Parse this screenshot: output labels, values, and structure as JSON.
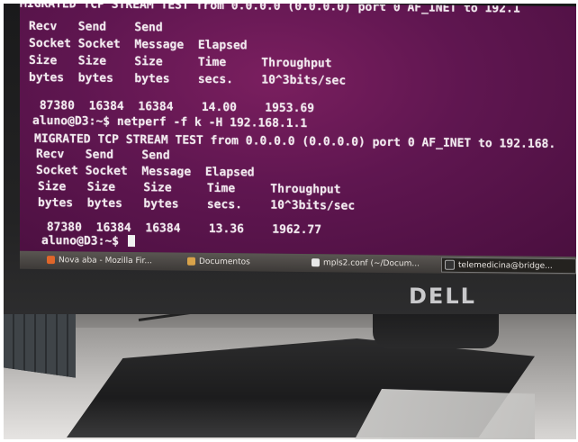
{
  "terminal": {
    "lines": [
      "MIGRATED TCP STREAM TEST from 0.0.0.0 (0.0.0.0) port 0 AF_INET to 192.1",
      "Recv   Send    Send",
      "Socket Socket  Message  Elapsed",
      "Size   Size    Size     Time     Throughput",
      "bytes  bytes   bytes    secs.    10^3bits/sec",
      "",
      " 87380  16384  16384    14.00    1953.69",
      "aluno@D3:~$ netperf -f k -H 192.168.1.1",
      "MIGRATED TCP STREAM TEST from 0.0.0.0 (0.0.0.0) port 0 AF_INET to 192.168.",
      "Recv   Send    Send",
      "Socket Socket  Message  Elapsed",
      "Size   Size    Size     Time     Throughput",
      "bytes  bytes   bytes    secs.    10^3bits/sec",
      "",
      " 87380  16384  16384    13.36    1962.77",
      "aluno@D3:~$ "
    ]
  },
  "taskbar": {
    "items": [
      {
        "label": "Nova aba - Mozilla Fir...",
        "icon": "firefox-icon",
        "color": "#e0662a"
      },
      {
        "label": "Documentos",
        "icon": "folder-icon",
        "color": "#d8a24a"
      },
      {
        "label": "mpls2.conf (~/Docum...",
        "icon": "text-editor-icon",
        "color": "#e8e8e8"
      },
      {
        "label": "telemedicina@bridge...",
        "icon": "terminal-icon",
        "color": "#333333"
      }
    ]
  },
  "brand": {
    "logo": "DELL"
  }
}
